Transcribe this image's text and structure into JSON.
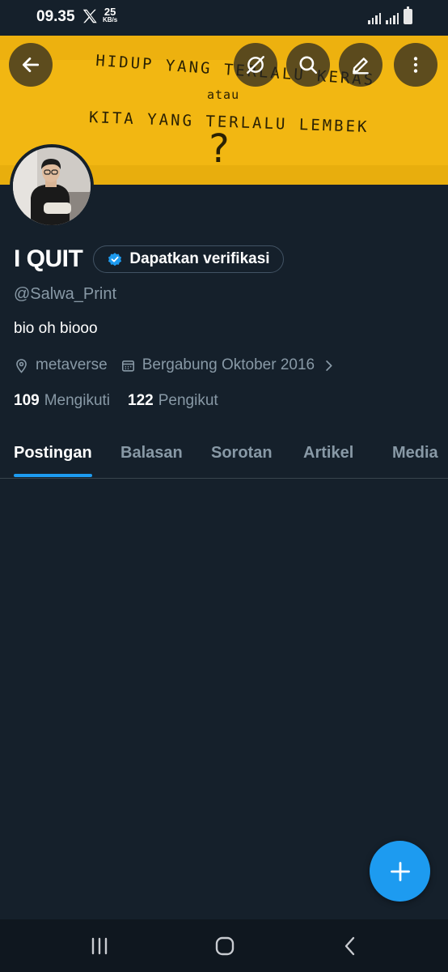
{
  "status_bar": {
    "time": "09.35",
    "speed_value": "25",
    "speed_unit": "KB/s"
  },
  "banner": {
    "line1": "HIDUP YANG TERLALU KERAS",
    "line2": "atau",
    "line3": "KITA YANG TERLALU LEMBEK",
    "line4": "?"
  },
  "header": {
    "back_icon": "arrow-left-icon",
    "grok_icon": "grok-icon",
    "search_icon": "search-icon",
    "edit_icon": "edit-icon",
    "more_icon": "more-vertical-icon"
  },
  "profile": {
    "display_name": "I QUIT",
    "verify_label": "Dapatkan verifikasi",
    "handle": "@Salwa_Print",
    "bio": "bio oh biooo",
    "location": "metaverse",
    "joined": "Bergabung Oktober 2016",
    "following_count": "109",
    "following_label": "Mengikuti",
    "followers_count": "122",
    "followers_label": "Pengikut"
  },
  "tabs": [
    {
      "label": "Postingan",
      "active": true
    },
    {
      "label": "Balasan",
      "active": false
    },
    {
      "label": "Sorotan",
      "active": false
    },
    {
      "label": "Artikel",
      "active": false
    },
    {
      "label": "Media",
      "active": false
    }
  ],
  "colors": {
    "background": "#15202b",
    "accent": "#1d9bf0",
    "secondary_text": "#8899a6",
    "banner": "#f2b712"
  }
}
